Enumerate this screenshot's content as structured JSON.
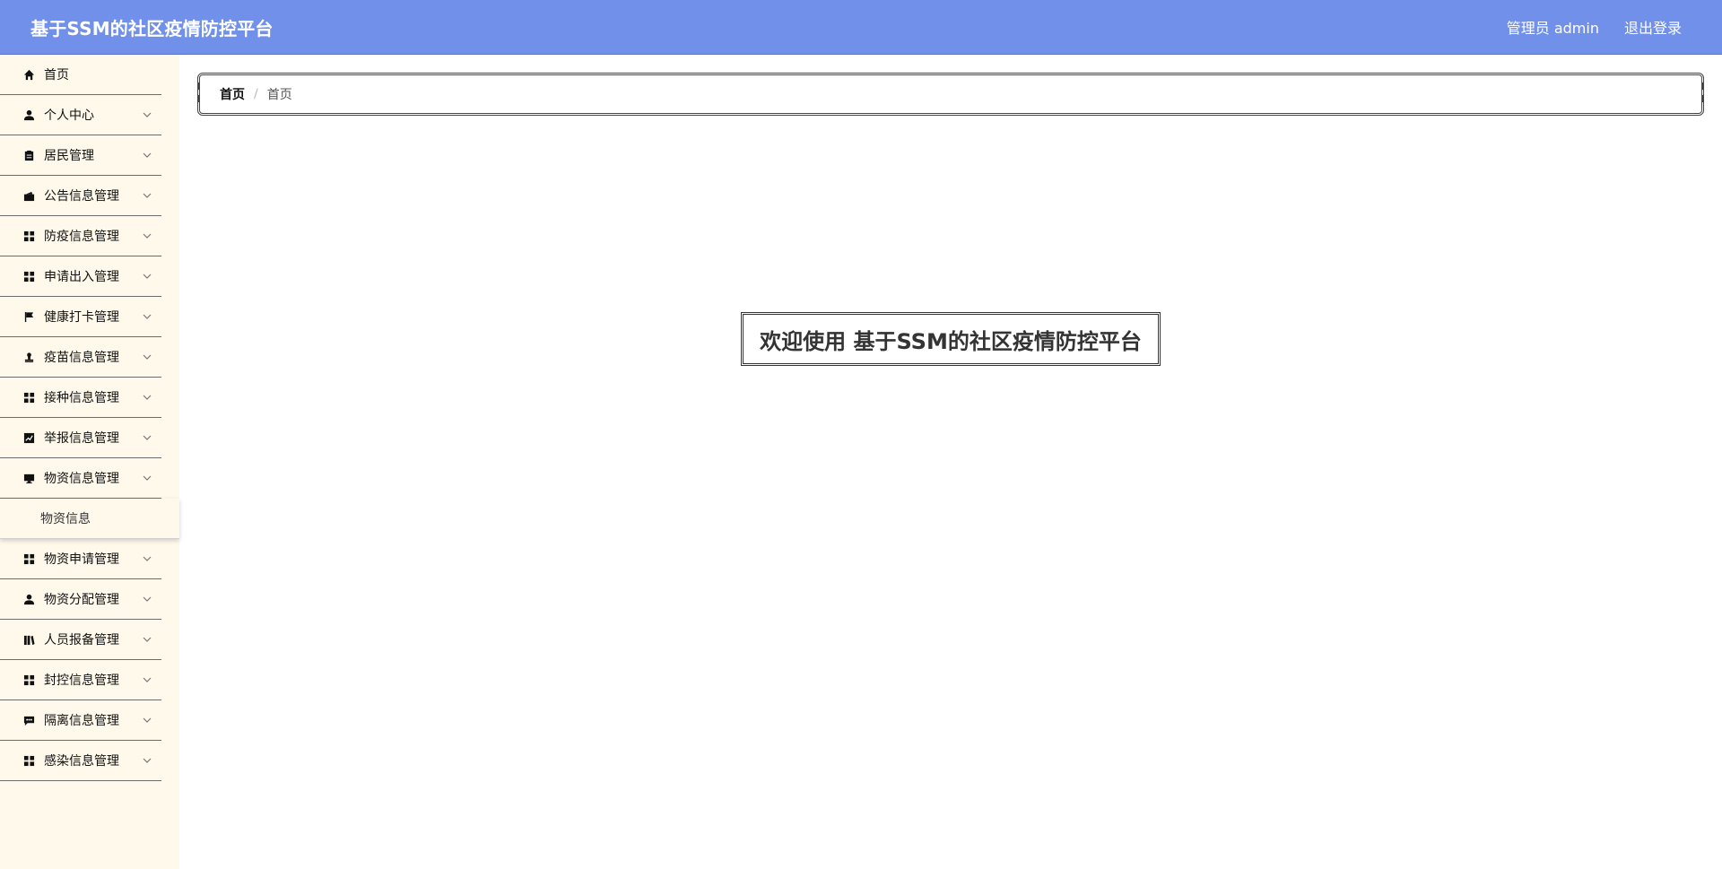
{
  "header": {
    "title": "基于SSM的社区疫情防控平台",
    "user_label": "管理员 admin",
    "logout_label": "退出登录"
  },
  "sidebar": {
    "items": [
      {
        "label": "首页",
        "icon": "home-icon"
      },
      {
        "label": "个人中心",
        "icon": "user-icon"
      },
      {
        "label": "居民管理",
        "icon": "clipboard-icon"
      },
      {
        "label": "公告信息管理",
        "icon": "wallet-icon"
      },
      {
        "label": "防疫信息管理",
        "icon": "grid-icon"
      },
      {
        "label": "申请出入管理",
        "icon": "grid-icon"
      },
      {
        "label": "健康打卡管理",
        "icon": "flag-icon"
      },
      {
        "label": "疫苗信息管理",
        "icon": "stamp-icon"
      },
      {
        "label": "接种信息管理",
        "icon": "grid-icon"
      },
      {
        "label": "举报信息管理",
        "icon": "chart-icon"
      },
      {
        "label": "物资信息管理",
        "icon": "monitor-icon"
      },
      {
        "label": "物资申请管理",
        "icon": "grid-icon"
      },
      {
        "label": "物资分配管理",
        "icon": "user-icon"
      },
      {
        "label": "人员报备管理",
        "icon": "books-icon"
      },
      {
        "label": "封控信息管理",
        "icon": "grid-icon"
      },
      {
        "label": "隔离信息管理",
        "icon": "message-icon"
      },
      {
        "label": "感染信息管理",
        "icon": "grid-icon"
      }
    ],
    "submenu": {
      "label": "物资信息"
    }
  },
  "breadcrumb": {
    "home": "首页",
    "separator": "/",
    "current": "首页"
  },
  "main": {
    "welcome": "欢迎使用 基于SSM的社区疫情防控平台"
  },
  "colors": {
    "header_bg": "#7090e9",
    "sidebar_bg": "#fff9ec"
  }
}
